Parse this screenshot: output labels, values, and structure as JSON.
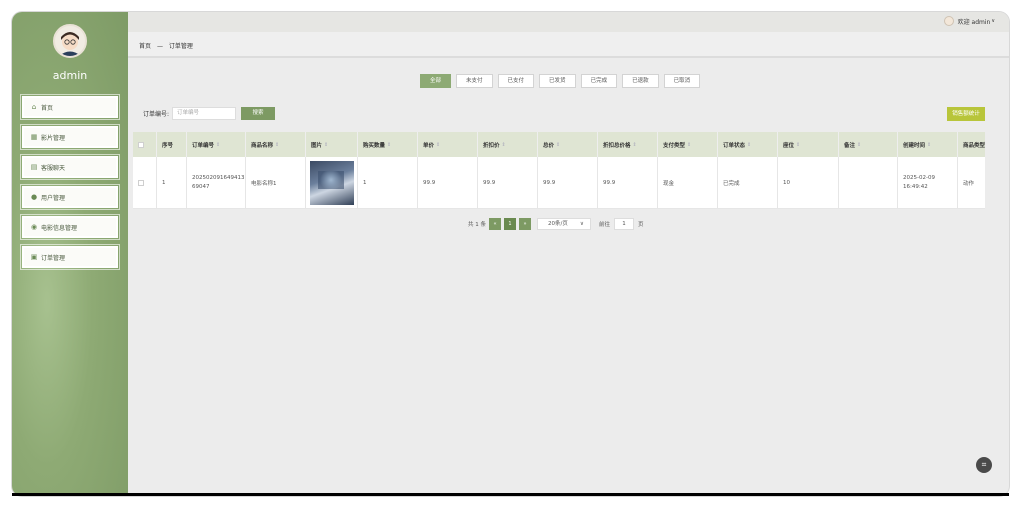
{
  "sidebar": {
    "admin_name": "admin",
    "items": [
      {
        "label": "首页",
        "icon": "home-icon"
      },
      {
        "label": "影片管理",
        "icon": "film-icon"
      },
      {
        "label": "客服聊天",
        "icon": "chat-icon"
      },
      {
        "label": "用户管理",
        "icon": "user-icon"
      },
      {
        "label": "电影信息管理",
        "icon": "movie-info-icon"
      },
      {
        "label": "订单管理",
        "icon": "order-icon"
      }
    ]
  },
  "topbar": {
    "welcome": "欢迎 admin"
  },
  "breadcrumb": {
    "home": "首页",
    "sep": "—",
    "current": "订单管理"
  },
  "status_tabs": [
    "全部",
    "未支付",
    "已支付",
    "已发货",
    "已完成",
    "已退款",
    "已取消"
  ],
  "search": {
    "label": "订单编号:",
    "placeholder": "订单编号",
    "button": "搜索"
  },
  "sales_button": "销售额统计",
  "table": {
    "headers": [
      "序号",
      "订单编号",
      "商品名称",
      "图片",
      "购买数量",
      "单价",
      "折扣价",
      "总价",
      "折扣总价格",
      "支付类型",
      "订单状态",
      "座位",
      "备注",
      "创建时间",
      "商品类型"
    ],
    "rows": [
      {
        "index": "1",
        "order_no": "202502091649413 69047",
        "product": "电影名称1",
        "qty": "1",
        "unit_price": "99.9",
        "discount_price": "99.9",
        "total": "99.9",
        "discount_total": "99.9",
        "pay_type": "现金",
        "status": "已完成",
        "seat": "10",
        "remark": "",
        "created": "2025-02-09 16:49:42",
        "type": "动作"
      }
    ]
  },
  "pagination": {
    "total": "共 1 条",
    "page": "1",
    "page_size": "20条/页",
    "goto": "前往",
    "goto_value": "1",
    "page_unit": "页"
  },
  "colors": {
    "accent": "#7d9a63",
    "sidebar": "#8eaa74",
    "sales": "#b8c53a"
  }
}
